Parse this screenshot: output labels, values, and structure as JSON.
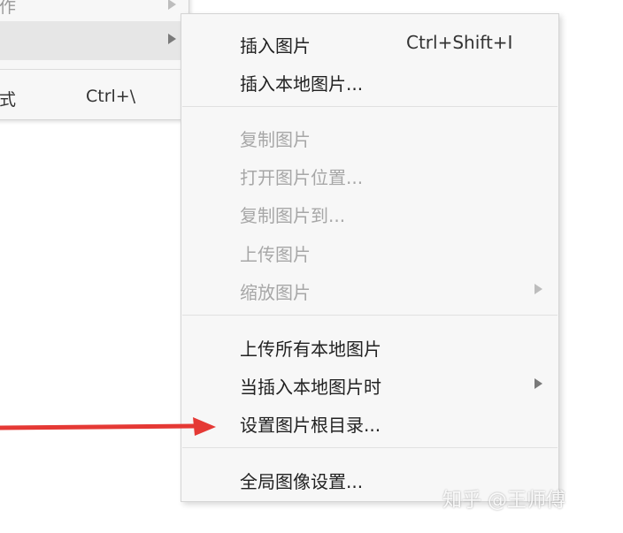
{
  "parent_menu": {
    "items": [
      {
        "label": "作"
      },
      {
        "label": ""
      },
      {
        "label": "式",
        "shortcut": "Ctrl+\\"
      }
    ]
  },
  "submenu": {
    "items": [
      {
        "label": "插入图片",
        "shortcut": "Ctrl+Shift+I"
      },
      {
        "label": "插入本地图片..."
      },
      {
        "label": "复制图片"
      },
      {
        "label": "打开图片位置..."
      },
      {
        "label": "复制图片到..."
      },
      {
        "label": "上传图片"
      },
      {
        "label": "缩放图片"
      },
      {
        "label": "上传所有本地图片"
      },
      {
        "label": "当插入本地图片时"
      },
      {
        "label": "设置图片根目录..."
      },
      {
        "label": "全局图像设置..."
      }
    ]
  },
  "watermark": {
    "text": "知乎 @王师傅"
  },
  "colors": {
    "annotation_arrow": "#e53935",
    "menu_background": "#f7f7f7",
    "highlight": "#e6e6e6",
    "disabled_text": "#a7a7a7"
  }
}
